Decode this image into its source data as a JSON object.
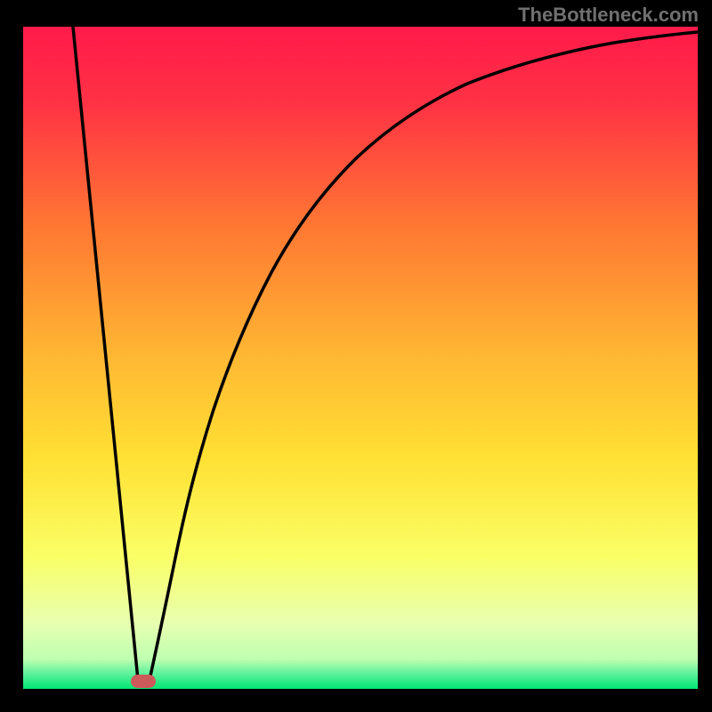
{
  "watermark": "TheBottleneck.com",
  "chart_data": {
    "type": "line",
    "title": "",
    "xlabel": "",
    "ylabel": "",
    "xlim": [
      0,
      100
    ],
    "ylim": [
      0,
      100
    ],
    "grid": false,
    "legend": false,
    "gradient_colors": {
      "top": "#ff1a4a",
      "upper_mid": "#ff7a33",
      "mid": "#ffd633",
      "lower_mid": "#f7ff66",
      "bottom": "#00e673"
    },
    "series": [
      {
        "name": "curve-left",
        "x": [
          7.5,
          16.5
        ],
        "y": [
          100,
          1
        ]
      },
      {
        "name": "curve-right",
        "x": [
          18.5,
          22,
          26,
          30,
          35,
          40,
          46,
          53,
          60,
          68,
          76,
          85,
          94,
          100
        ],
        "y": [
          1,
          20,
          37,
          49,
          60,
          68,
          75,
          81,
          85,
          88.5,
          91,
          93,
          94.5,
          95.2
        ]
      }
    ],
    "marker": {
      "x": 17.3,
      "y": 1.3,
      "color": "#cc5a5a",
      "shape": "rounded-rect"
    },
    "frame": {
      "border_color": "#000000",
      "border_width": 15
    }
  }
}
